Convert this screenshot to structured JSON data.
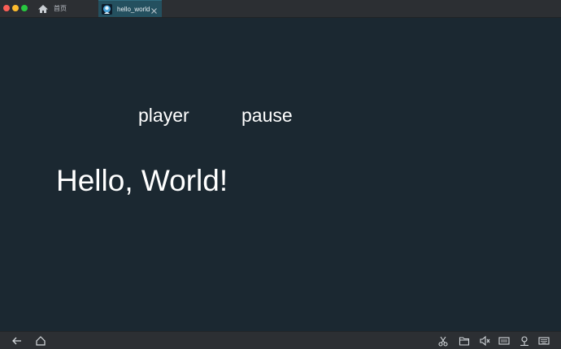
{
  "tabs": {
    "home_label": "首页",
    "active_label": "hello_world"
  },
  "app": {
    "player_label": "player",
    "pause_label": "pause",
    "hello_text": "Hello, World!"
  },
  "toolbar": {
    "left_icons": [
      "back-arrow-icon",
      "home-icon"
    ],
    "right_icons": [
      "scissors-icon",
      "folder-icon",
      "volume-icon",
      "resolution-icon",
      "location-icon",
      "keyboard-icon"
    ]
  },
  "colors": {
    "background": "#1b2831",
    "titlebar": "#2c2f33",
    "active_tab": "#24505f",
    "text": "#ffffff"
  }
}
